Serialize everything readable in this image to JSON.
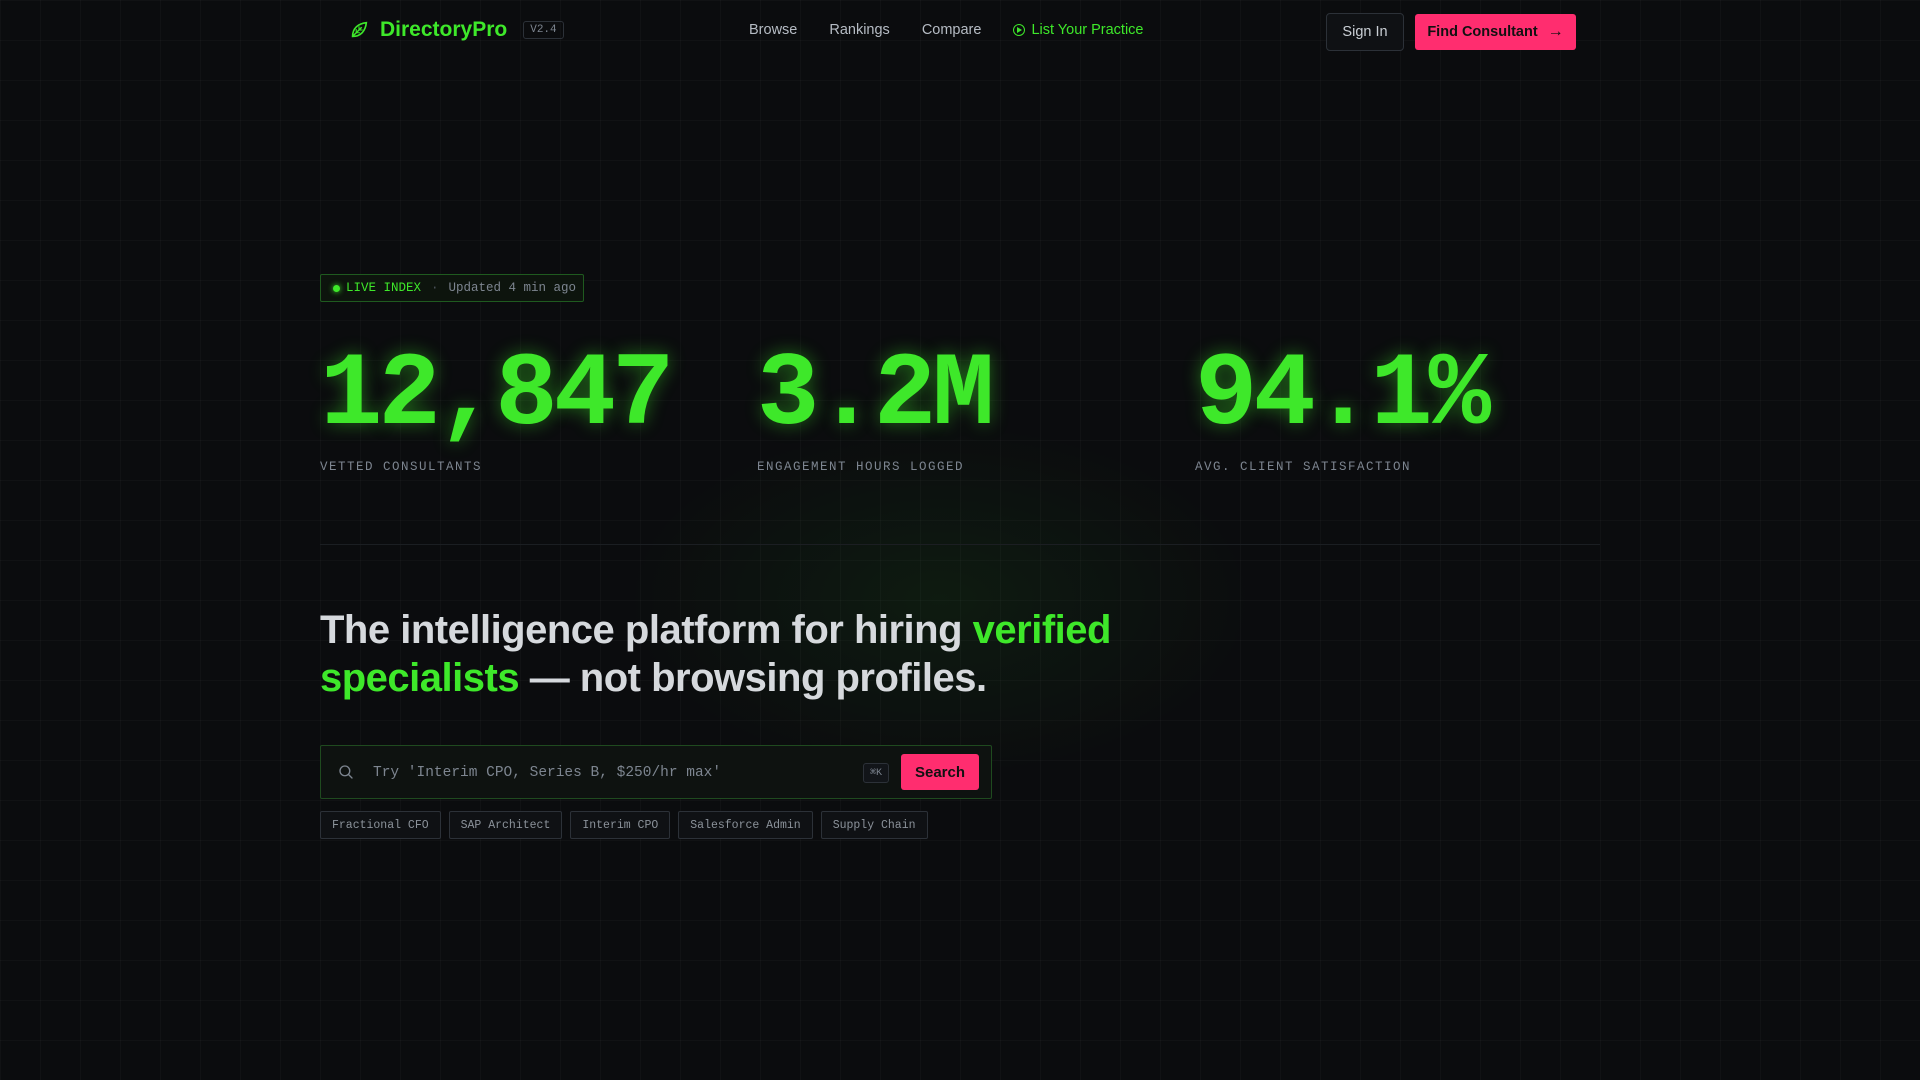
{
  "header": {
    "brand": "DirectoryPro",
    "version": "V2.4",
    "nav": [
      {
        "label": "Browse"
      },
      {
        "label": "Rankings"
      },
      {
        "label": "Compare"
      },
      {
        "label": "List Your Practice"
      }
    ],
    "sign_in": "Sign In",
    "find_consultant": "Find Consultant"
  },
  "live": {
    "label": "LIVE INDEX",
    "separator": "·",
    "updated": "Updated 4 min ago"
  },
  "stats": [
    {
      "value": "12,847",
      "label": "VETTED CONSULTANTS"
    },
    {
      "value": "3.2M",
      "label": "ENGAGEMENT HOURS LOGGED"
    },
    {
      "value": "94.1%",
      "label": "AVG. CLIENT SATISFACTION"
    }
  ],
  "headline": {
    "part1": "The intelligence platform for hiring ",
    "highlight": "verified specialists",
    "part2": " — not browsing profiles."
  },
  "search": {
    "placeholder": "Try 'Interim CPO, Series B, $250/hr max'",
    "value": "",
    "shortcut": "⌘K",
    "button": "Search"
  },
  "chips": [
    "Fractional CFO",
    "SAP Architect",
    "Interim CPO",
    "Salesforce Admin",
    "Supply Chain"
  ],
  "colors": {
    "accent": "#3ee82a",
    "cta": "#ff2d6f",
    "background": "#0b0c0e"
  },
  "icons": {
    "logo": "leaf-icon",
    "list_practice": "play-circle-icon",
    "search": "search-icon",
    "arrow": "arrow-right-icon"
  }
}
